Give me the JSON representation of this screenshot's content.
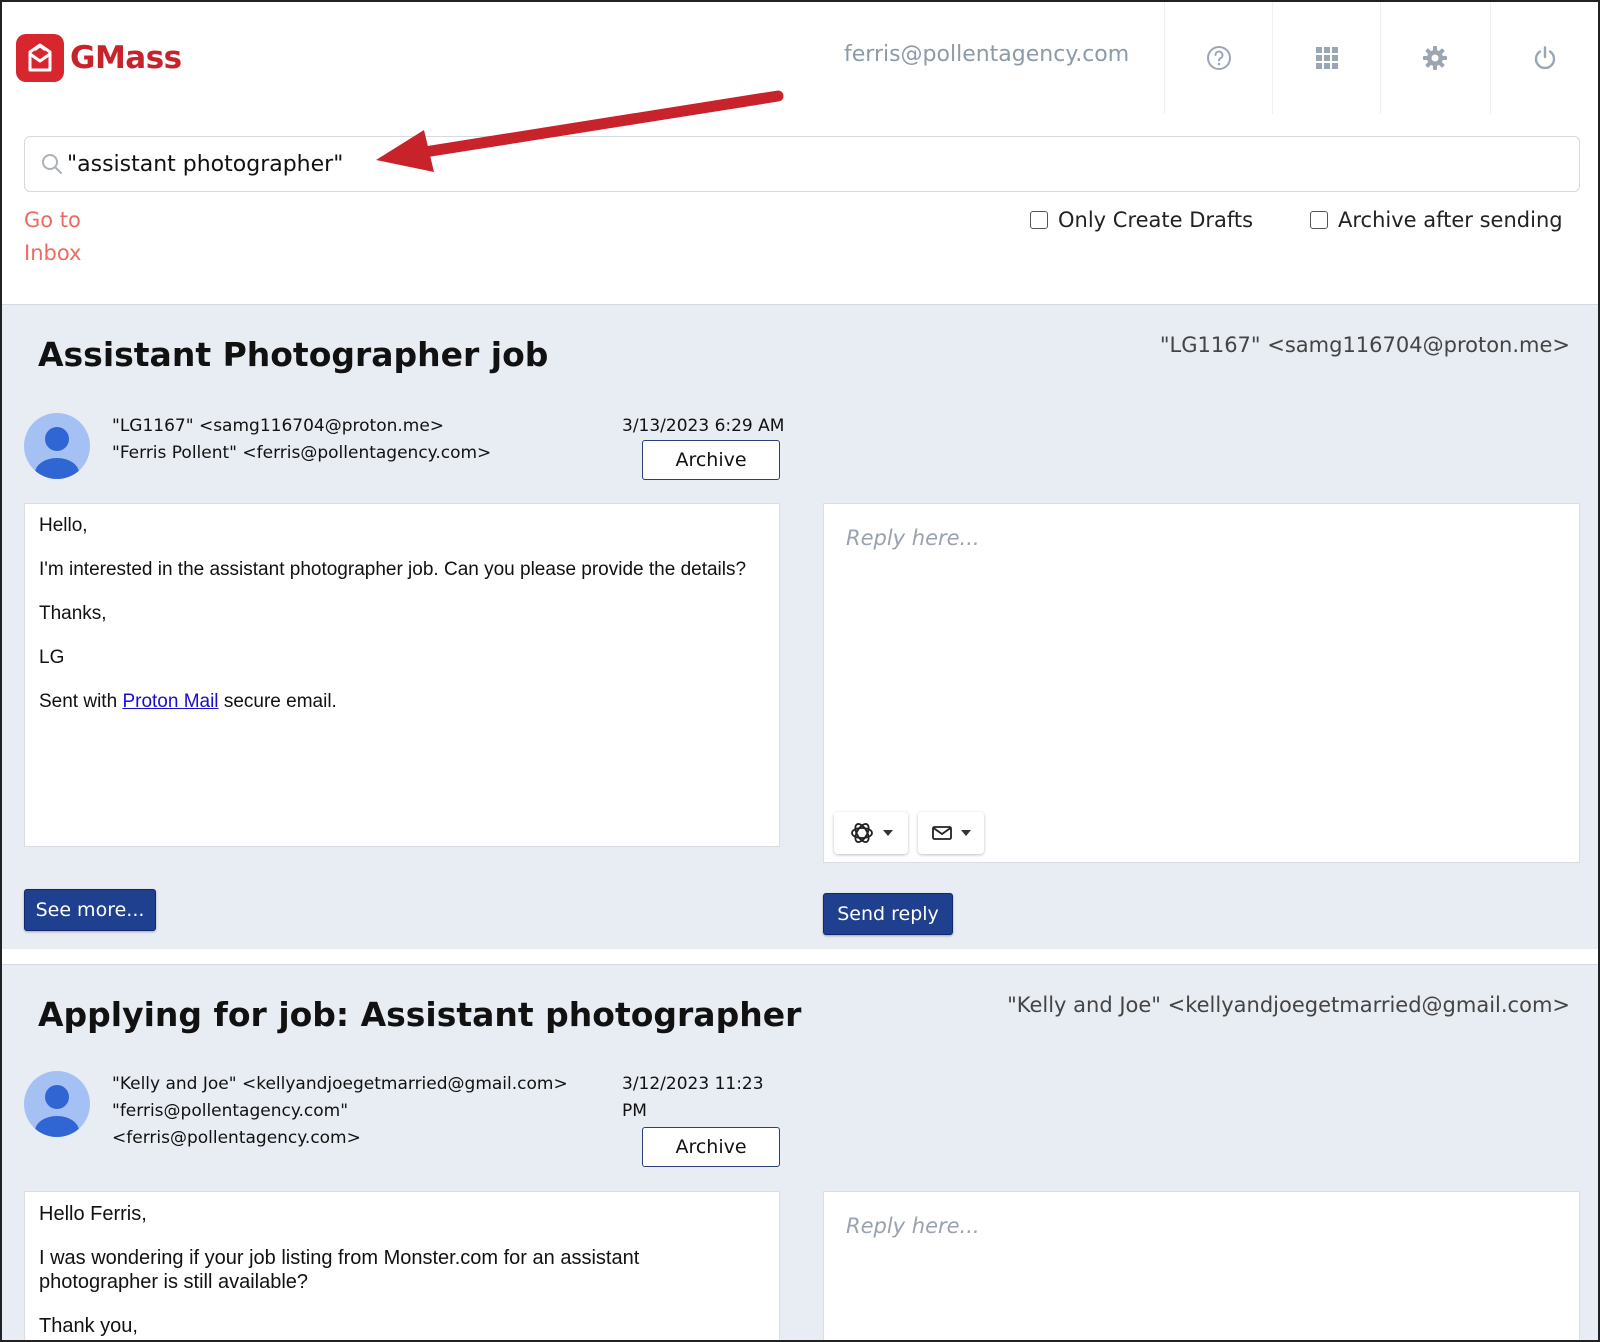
{
  "brand": {
    "name": "GMass",
    "color": "#c8222b"
  },
  "header": {
    "account_email": "ferris@pollentagency.com",
    "icons": [
      "help-icon",
      "apps-grid-icon",
      "gear-icon",
      "power-icon"
    ]
  },
  "search": {
    "value": "\"assistant photographer\""
  },
  "nav": {
    "go_to_inbox": "Go to Inbox"
  },
  "options": {
    "only_create_drafts": {
      "label": "Only Create Drafts",
      "checked": false
    },
    "archive_after_sending": {
      "label": "Archive after sending",
      "checked": false
    }
  },
  "emails": [
    {
      "subject": "Assistant Photographer job",
      "sender_display": "\"LG1167\" <samg116704@proton.me>",
      "from": "\"LG1167\" <samg116704@proton.me>",
      "to": "\"Ferris Pollent\" <ferris@pollentagency.com>",
      "date": "3/13/2023 6:29 AM",
      "archive_label": "Archive",
      "body": {
        "greeting": "Hello,",
        "line1": "I'm interested in the assistant photographer job. Can you please provide the details?",
        "thanks": "Thanks,",
        "signature": "LG",
        "footer_prefix": "Sent with ",
        "footer_link": "Proton Mail",
        "footer_suffix": " secure email."
      },
      "see_more_label": "See more...",
      "reply_placeholder": "Reply here...",
      "send_reply_label": "Send reply"
    },
    {
      "subject": "Applying for job: Assistant photographer",
      "sender_display": "\"Kelly and Joe\" <kellyandjoegetmarried@gmail.com>",
      "from": "\"Kelly and Joe\" <kellyandjoegetmarried@gmail.com>",
      "to_line1": "\"ferris@pollentagency.com\"",
      "to_line2": "<ferris@pollentagency.com>",
      "date_line1": "3/12/2023 11:23",
      "date_line2": "PM",
      "archive_label": "Archive",
      "body": {
        "greeting": "Hello Ferris,",
        "line1": "I was wondering if your job listing from Monster.com for an assistant photographer is still available?",
        "line2": "Thank you,"
      },
      "reply_placeholder": "Reply here..."
    }
  ]
}
